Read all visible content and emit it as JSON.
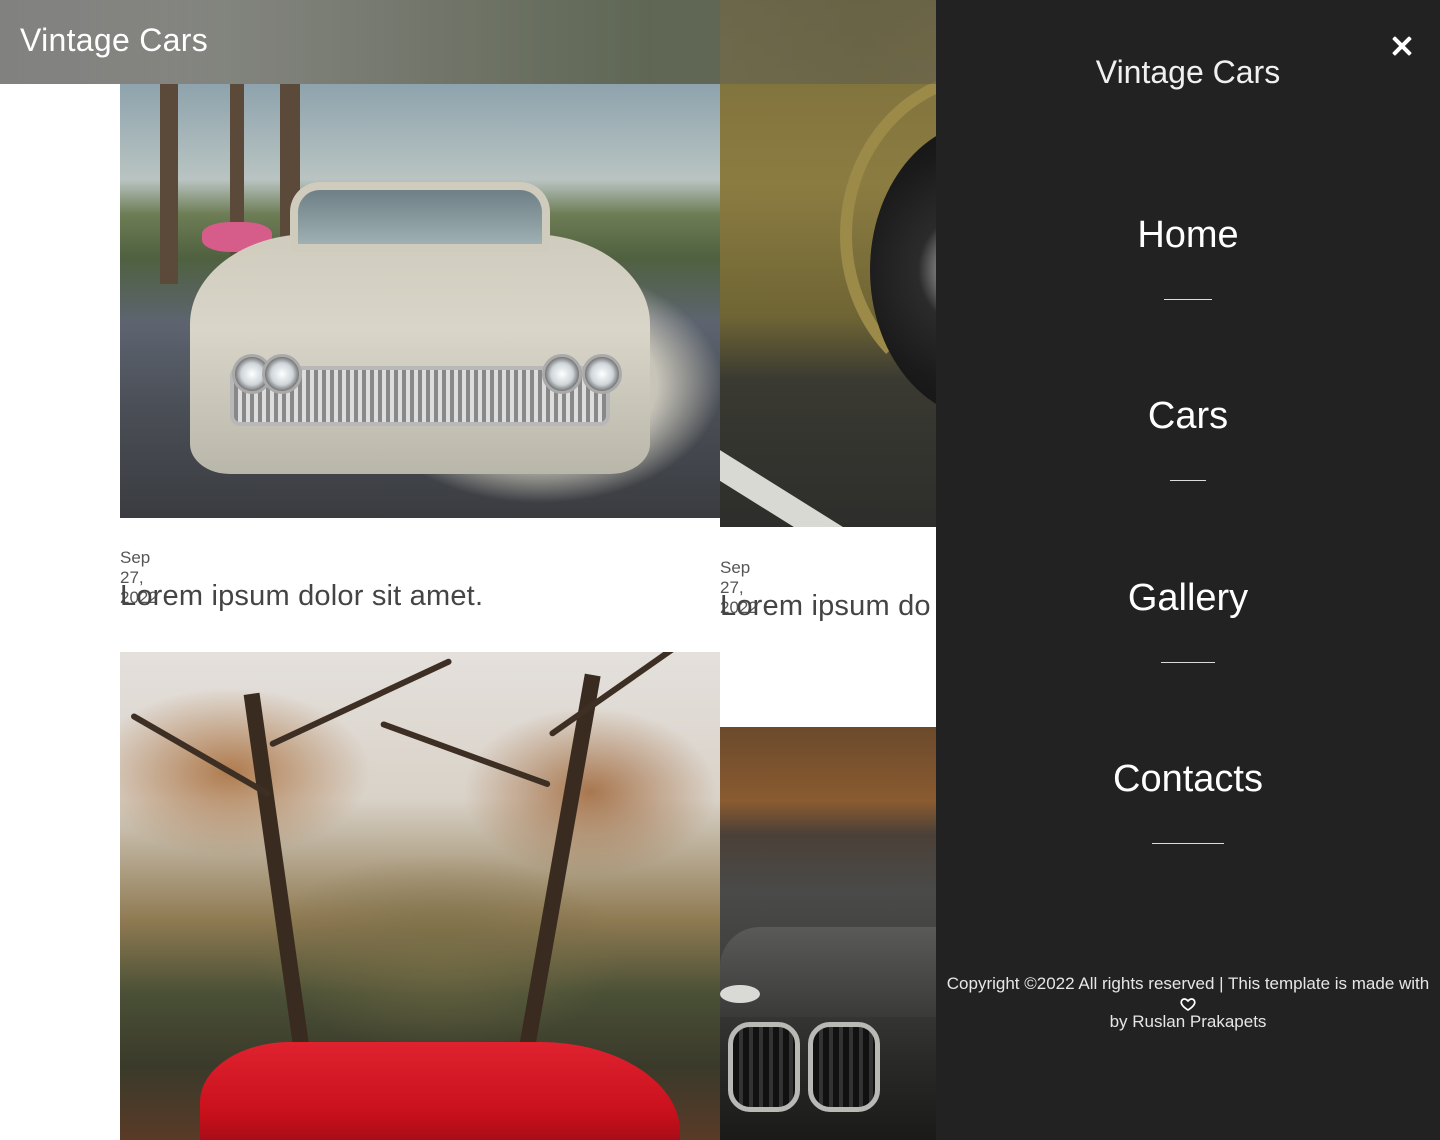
{
  "header": {
    "brand": "Vintage Cars"
  },
  "posts": [
    {
      "date": "Sep 27, 2022",
      "title": "Lorem ipsum dolor sit amet."
    },
    {
      "date": "Sep 27, 2022",
      "title": "Lorem ipsum do"
    }
  ],
  "menu": {
    "brand": "Vintage Cars",
    "close_icon": "close-icon",
    "items": [
      {
        "label": "Home"
      },
      {
        "label": "Cars"
      },
      {
        "label": "Gallery"
      },
      {
        "label": "Contacts"
      }
    ],
    "footer": {
      "line1": "Copyright ©2022 All rights reserved | This template is made with",
      "heart_icon": "heart-icon",
      "line2": "by Ruslan Prakapets"
    }
  },
  "colors": {
    "menu_background": "#222222",
    "menu_text": "#ffffff"
  }
}
